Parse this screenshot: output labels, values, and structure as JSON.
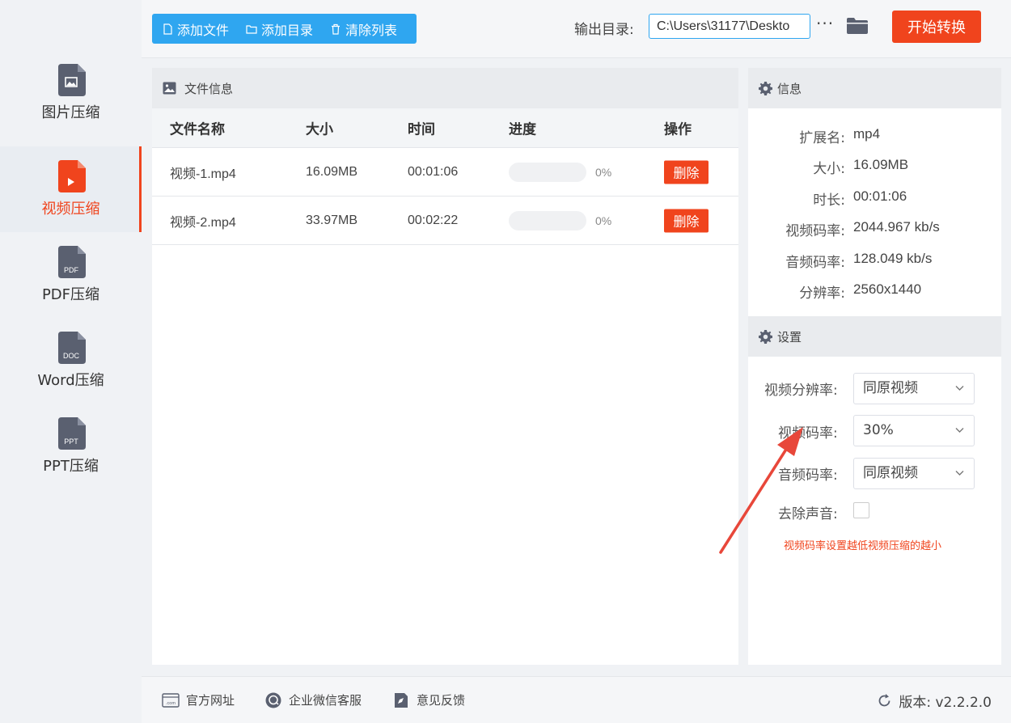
{
  "sidebar": {
    "items": [
      {
        "label": "图片压缩",
        "badge": ""
      },
      {
        "label": "视频压缩",
        "badge": ""
      },
      {
        "label": "PDF压缩",
        "badge": "PDF"
      },
      {
        "label": "Word压缩",
        "badge": "DOC"
      },
      {
        "label": "PPT压缩",
        "badge": "PPT"
      }
    ],
    "active_index": 1
  },
  "toolbar": {
    "add_file": "添加文件",
    "add_folder": "添加目录",
    "clear_list": "清除列表",
    "output_label": "输出目录:",
    "output_path": "C:\\Users\\31177\\Deskto",
    "more": "···",
    "start": "开始转换"
  },
  "file_panel": {
    "title": "文件信息",
    "columns": [
      "文件名称",
      "大小",
      "时间",
      "进度",
      "操作"
    ],
    "rows": [
      {
        "name": "视频-1.mp4",
        "size": "16.09MB",
        "time": "00:01:06",
        "progress": "0%",
        "action": "删除"
      },
      {
        "name": "视频-2.mp4",
        "size": "33.97MB",
        "time": "00:02:22",
        "progress": "0%",
        "action": "删除"
      }
    ]
  },
  "info": {
    "title": "信息",
    "fields": [
      {
        "key": "扩展名:",
        "value": "mp4"
      },
      {
        "key": "大小:",
        "value": "16.09MB"
      },
      {
        "key": "时长:",
        "value": "00:01:06"
      },
      {
        "key": "视频码率:",
        "value": "2044.967 kb/s"
      },
      {
        "key": "音频码率:",
        "value": "128.049 kb/s"
      },
      {
        "key": "分辨率:",
        "value": "2560x1440"
      }
    ]
  },
  "settings": {
    "title": "设置",
    "video_resolution_label": "视频分辨率:",
    "video_resolution_value": "同原视频",
    "video_bitrate_label": "视频码率:",
    "video_bitrate_value": "30%",
    "audio_bitrate_label": "音频码率:",
    "audio_bitrate_value": "同原视频",
    "remove_audio_label": "去除声音:",
    "remove_audio_checked": false,
    "hint": "视频码率设置越低视频压缩的越小"
  },
  "footer": {
    "website": "官方网址",
    "wechat": "企业微信客服",
    "feedback": "意见反馈",
    "version": "版本: v2.2.2.0"
  },
  "colors": {
    "accent": "#f0441d",
    "primary": "#2fa6f0",
    "icon": "#5a6070"
  }
}
